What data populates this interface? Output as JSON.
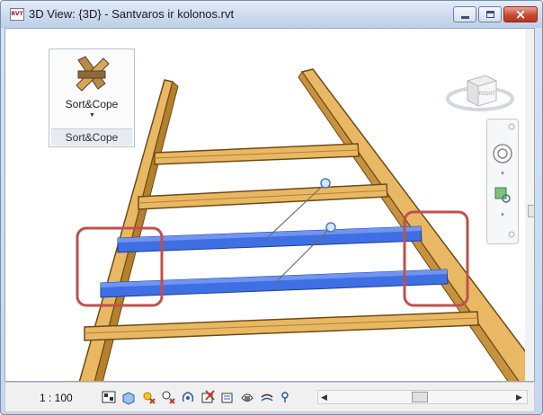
{
  "window": {
    "app_icon": "RVT",
    "title": "3D View: {3D} - Santvaros ir kolonos.rvt",
    "controls": [
      "minimize",
      "maximize",
      "close"
    ]
  },
  "addin_panel": {
    "button_label": "Sort&Cope",
    "panel_label": "Sort&Cope",
    "icon": "sort-cope-icon"
  },
  "viewcube": {
    "face_label": "RIGHT"
  },
  "statusbar": {
    "scale": "1 : 100",
    "icons": [
      "detail-level-icon",
      "visual-style-icon",
      "sun-path-icon",
      "shadows-icon",
      "crop-view-icon",
      "show-crop-icon",
      "unlock-3d-icon",
      "temporary-hide-icon",
      "reveal-hidden-icon",
      "analytical-model-icon"
    ]
  },
  "colors": {
    "beam_wood": "#e9b865",
    "beam_edge": "#6e4a15",
    "selected_beam": "#2f5fdc",
    "highlight_box": "#c0504d",
    "titlebar": "#cbd9ee"
  }
}
